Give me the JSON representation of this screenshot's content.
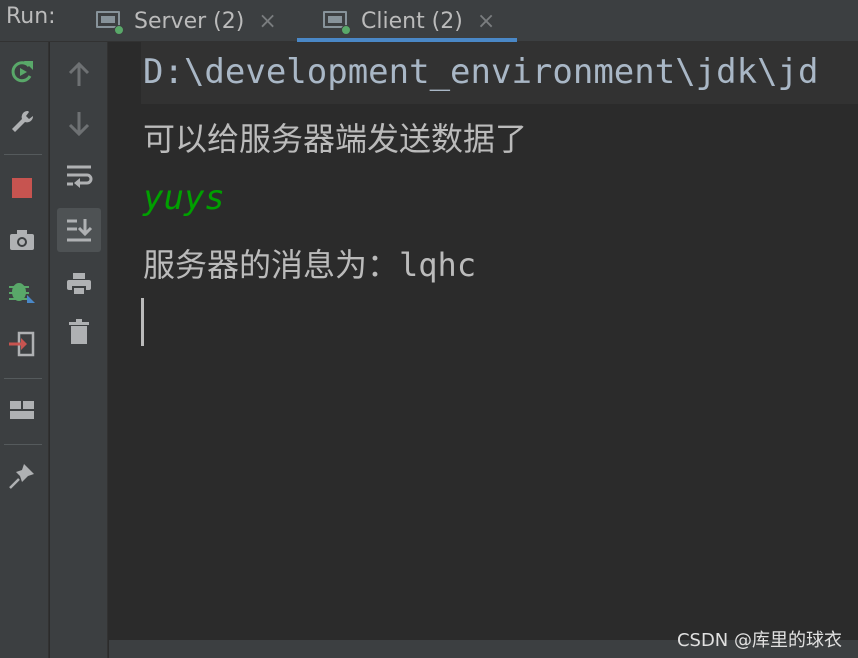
{
  "header": {
    "run_label": "Run:",
    "tabs": [
      {
        "label": "Server (2)",
        "close": "×",
        "active": false
      },
      {
        "label": "Client (2)",
        "close": "×",
        "active": true
      }
    ]
  },
  "toolbar": {
    "primary": [
      "rerun-icon",
      "wrench-icon",
      "stop-icon",
      "camera-icon",
      "debug-icon",
      "exit-icon",
      "layout-icon",
      "pin-icon"
    ],
    "secondary": [
      "up-arrow-icon",
      "down-arrow-icon",
      "soft-wrap-icon",
      "scroll-to-end-icon",
      "print-icon",
      "trash-icon"
    ]
  },
  "console": {
    "command": "D:\\development_environment\\jdk\\jd",
    "line1": "可以给服务器端发送数据了",
    "user_input": "yuys",
    "line3_prefix": "服务器的消息为：",
    "line3_value": "lqhc"
  },
  "watermark": "CSDN @库里的球衣",
  "colors": {
    "accent": "#4a88c7",
    "input_green": "#00a000",
    "stop_red": "#c75450",
    "run_green": "#59a869"
  }
}
